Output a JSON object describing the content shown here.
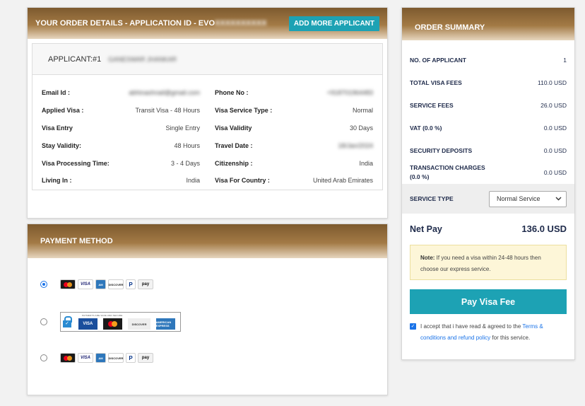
{
  "order_details": {
    "title_prefix": "YOUR ORDER DETAILS - APPLICATION ID - ",
    "title_visible_id": "EVO",
    "title_blurred_id": "XXXXXXXXXX",
    "add_button": "ADD MORE APPLICANT",
    "applicant_label": "APPLICANT:#1",
    "applicant_name_blurred": "GANESWAR JHANKAR",
    "left_fields": [
      {
        "label": "Email Id :",
        "value": "abhinashnail@gmail.com",
        "blurred": true
      },
      {
        "label": "Applied Visa :",
        "value": "Transit Visa - 48 Hours"
      },
      {
        "label": "Visa Entry",
        "value": "Single Entry"
      },
      {
        "label": "Stay Validity:",
        "value": "48 Hours"
      },
      {
        "label": "Visa Processing Time:",
        "value": "3 - 4 Days"
      },
      {
        "label": "Living In :",
        "value": "India"
      }
    ],
    "right_fields": [
      {
        "label": "Phone No :",
        "value": "+918701964483",
        "blurred": true
      },
      {
        "label": "Visa Service Type :",
        "value": "Normal"
      },
      {
        "label": "Visa Validity",
        "value": "30 Days"
      },
      {
        "label": "Travel Date :",
        "value": "18/Jan/2024",
        "blurred": true
      },
      {
        "label": "Citizenship :",
        "value": "India"
      },
      {
        "label": "Visa For Country :",
        "value": "United Arab Emirates"
      }
    ]
  },
  "payment": {
    "title": "PAYMENT METHOD",
    "secure_caption": "PAYMENTS ARE SAFE AND SECURE",
    "card_labels": {
      "visa": "VISA",
      "amex": "AMERICAN EXPRESS",
      "discover": "DISCOVER",
      "paypal": "P",
      "amazonpay": "pay"
    }
  },
  "summary": {
    "title": "ORDER SUMMARY",
    "rows": [
      {
        "label": "NO. OF APPLICANT",
        "value": "1"
      },
      {
        "label": "TOTAL VISA FEES",
        "value": "110.0 USD"
      },
      {
        "label": "SERVICE FEES",
        "value": "26.0 USD"
      },
      {
        "label": "VAT (0.0 %)",
        "value": "0.0 USD"
      },
      {
        "label": "SECURITY DEPOSITS",
        "value": "0.0 USD"
      },
      {
        "label": "TRANSACTION CHARGES (0.0 %)",
        "value": "0.0 USD"
      }
    ],
    "service_type_label": "SERVICE TYPE",
    "service_type_value": "Normal Service",
    "net_pay_label": "Net Pay",
    "net_pay_value": "136.0 USD",
    "note_bold": "Note:",
    "note_text": " If you need a visa within 24-48 hours then choose our express service.",
    "pay_button": "Pay Visa Fee",
    "terms_prefix": "I accept that i have read & agreed to the ",
    "terms_link": "Terms & conditions and refund policy",
    "terms_suffix": " for this service."
  },
  "colors": {
    "accent": "#1da2b4",
    "header_brown": "#7d5a2f",
    "link": "#1a73e8"
  }
}
